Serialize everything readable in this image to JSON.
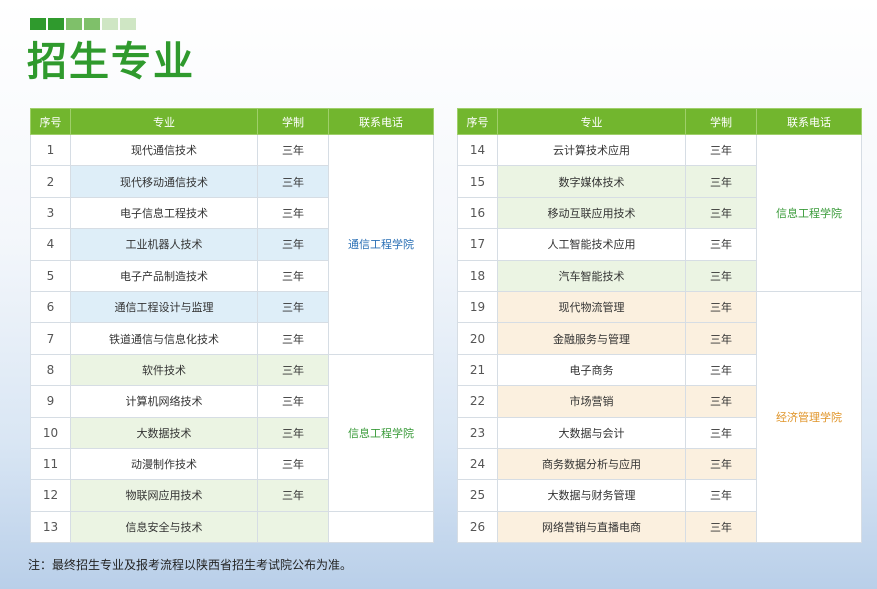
{
  "header": {
    "title": "招生专业",
    "square_colors": [
      "#2f9a2d",
      "#2f9a2d",
      "#7fc06a",
      "#7fc06a",
      "#cfe6c4",
      "#cfe6c4"
    ]
  },
  "table_left": {
    "headers": [
      "序号",
      "专业",
      "学制",
      "联系电话"
    ],
    "rows": [
      {
        "no": "1",
        "major": "现代通信技术",
        "years": "三年",
        "tone": "white"
      },
      {
        "no": "2",
        "major": "现代移动通信技术",
        "years": "三年",
        "tone": "blue"
      },
      {
        "no": "3",
        "major": "电子信息工程技术",
        "years": "三年",
        "tone": "white"
      },
      {
        "no": "4",
        "major": "工业机器人技术",
        "years": "三年",
        "tone": "blue"
      },
      {
        "no": "5",
        "major": "电子产品制造技术",
        "years": "三年",
        "tone": "white"
      },
      {
        "no": "6",
        "major": "通信工程设计与监理",
        "years": "三年",
        "tone": "blue"
      },
      {
        "no": "7",
        "major": "铁道通信与信息化技术",
        "years": "三年",
        "tone": "white"
      },
      {
        "no": "8",
        "major": "软件技术",
        "years": "三年",
        "tone": "green"
      },
      {
        "no": "9",
        "major": "计算机网络技术",
        "years": "三年",
        "tone": "white"
      },
      {
        "no": "10",
        "major": "大数据技术",
        "years": "三年",
        "tone": "green"
      },
      {
        "no": "11",
        "major": "动漫制作技术",
        "years": "三年",
        "tone": "white"
      },
      {
        "no": "12",
        "major": "物联网应用技术",
        "years": "三年",
        "tone": "green"
      },
      {
        "no": "13",
        "major": "信息安全与技术",
        "years": "",
        "tone": "green"
      }
    ],
    "groups": [
      {
        "name": "通信工程学院",
        "start": 0,
        "span": 7,
        "color": "#2a6fb5"
      },
      {
        "name": "信息工程学院",
        "start": 7,
        "span": 5,
        "color": "#3a9b3a"
      },
      {
        "name": "",
        "start": 12,
        "span": 1,
        "color": "#3a9b3a"
      }
    ]
  },
  "table_right": {
    "headers": [
      "序号",
      "专业",
      "学制",
      "联系电话"
    ],
    "rows": [
      {
        "no": "14",
        "major": "云计算技术应用",
        "years": "三年",
        "tone": "white"
      },
      {
        "no": "15",
        "major": "数字媒体技术",
        "years": "三年",
        "tone": "green"
      },
      {
        "no": "16",
        "major": "移动互联应用技术",
        "years": "三年",
        "tone": "green"
      },
      {
        "no": "17",
        "major": "人工智能技术应用",
        "years": "三年",
        "tone": "white"
      },
      {
        "no": "18",
        "major": "汽车智能技术",
        "years": "三年",
        "tone": "green"
      },
      {
        "no": "19",
        "major": "现代物流管理",
        "years": "三年",
        "tone": "tan"
      },
      {
        "no": "20",
        "major": "金融服务与管理",
        "years": "三年",
        "tone": "tan"
      },
      {
        "no": "21",
        "major": "电子商务",
        "years": "三年",
        "tone": "white"
      },
      {
        "no": "22",
        "major": "市场营销",
        "years": "三年",
        "tone": "tan"
      },
      {
        "no": "23",
        "major": "大数据与会计",
        "years": "三年",
        "tone": "white"
      },
      {
        "no": "24",
        "major": "商务数据分析与应用",
        "years": "三年",
        "tone": "tan"
      },
      {
        "no": "25",
        "major": "大数据与财务管理",
        "years": "三年",
        "tone": "white"
      },
      {
        "no": "26",
        "major": "网络营销与直播电商",
        "years": "三年",
        "tone": "tan"
      }
    ],
    "groups": [
      {
        "name": "信息工程学院",
        "start": 0,
        "span": 5,
        "color": "#3a9b3a"
      },
      {
        "name": "经济管理学院",
        "start": 5,
        "span": 8,
        "color": "#e0952a"
      }
    ]
  },
  "footer": {
    "note": "注：最终招生专业及报考流程以陕西省招生考试院公布为准。"
  }
}
